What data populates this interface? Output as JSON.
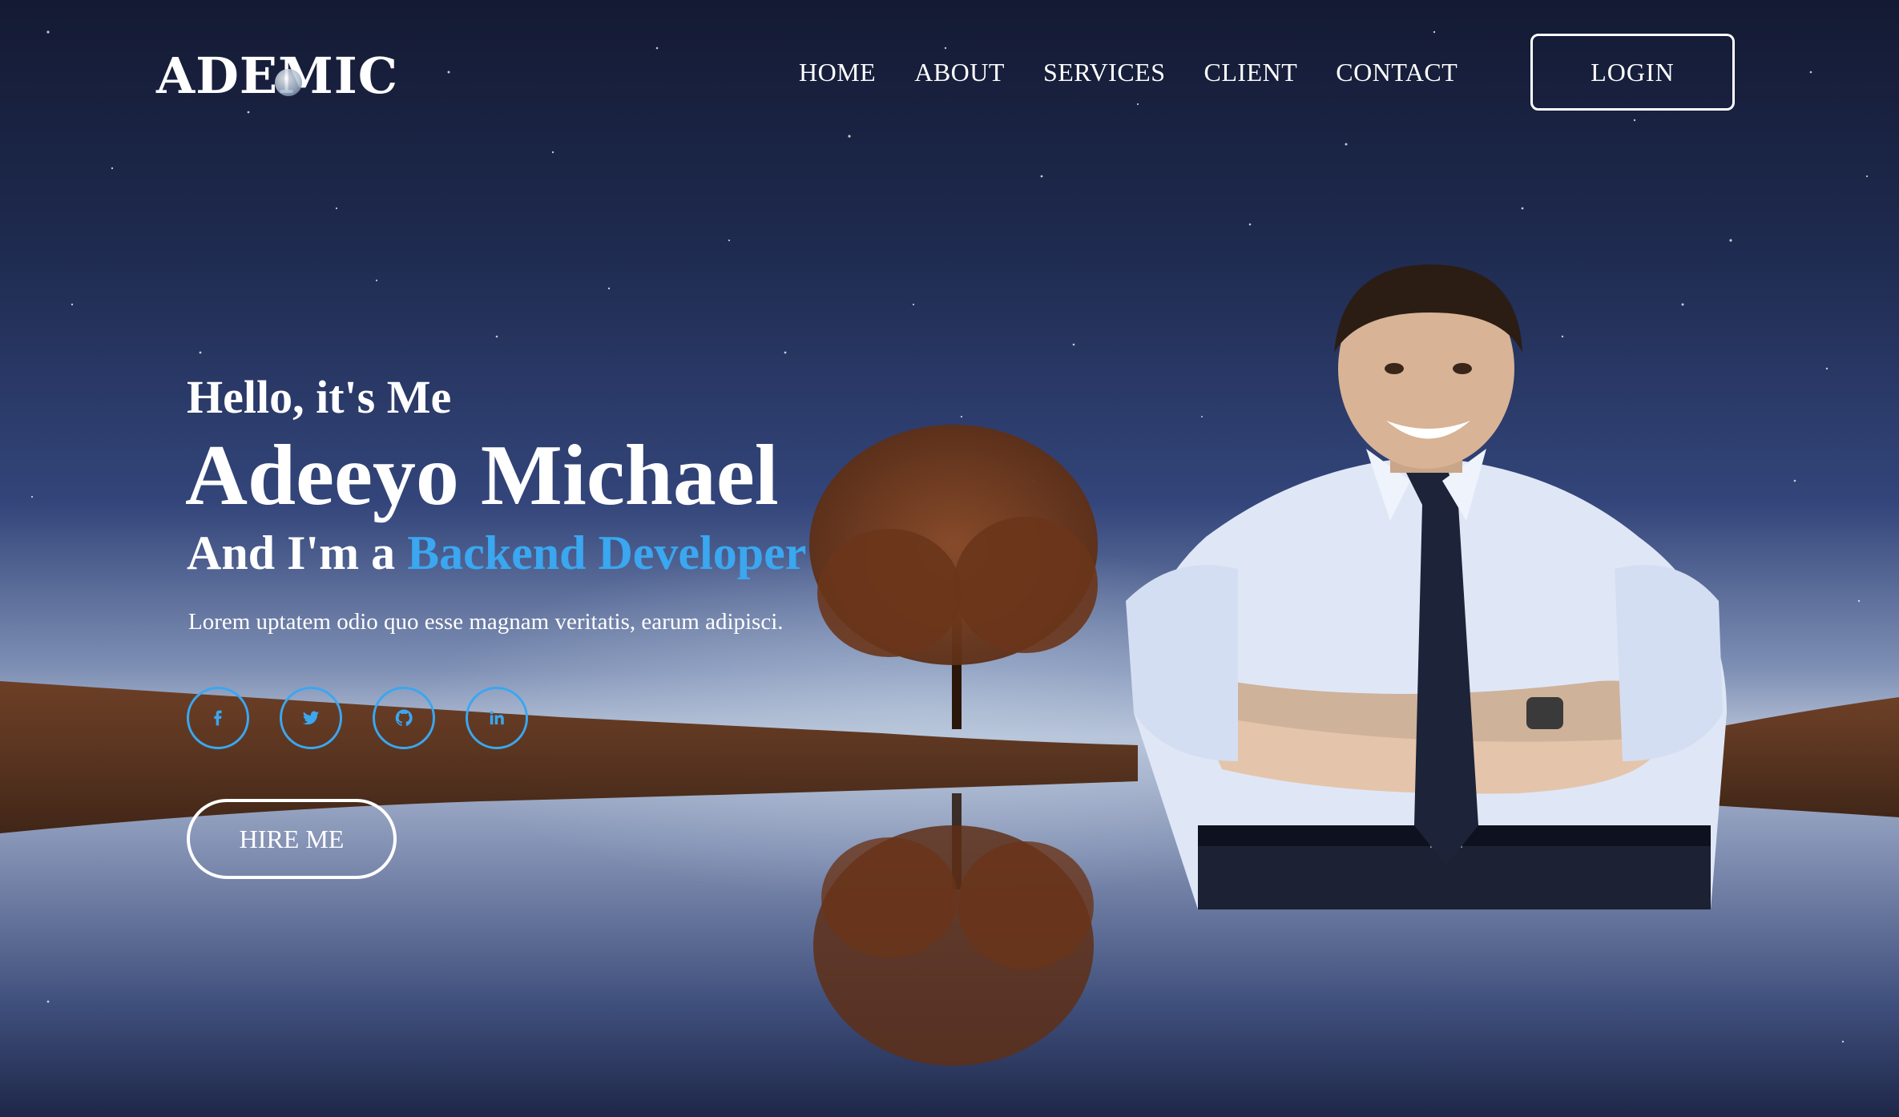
{
  "brand": {
    "logo_text": "ADEMIC"
  },
  "nav": {
    "items": [
      {
        "label": "HOME"
      },
      {
        "label": "ABOUT"
      },
      {
        "label": "SERVICES"
      },
      {
        "label": "CLIENT"
      },
      {
        "label": "CONTACT"
      }
    ],
    "login_label": "LOGIN"
  },
  "hero": {
    "greeting": "Hello, it's Me",
    "name": "Adeeyo Michael",
    "role_prefix": "And I'm a ",
    "role": "Backend Developer",
    "description": "Lorem uptatem odio quo esse magnam veritatis, earum adipisci.",
    "hire_label": "HIRE ME"
  },
  "socials": [
    {
      "icon": "facebook-icon",
      "glyph": "f"
    },
    {
      "icon": "twitter-icon",
      "glyph": "t"
    },
    {
      "icon": "github-icon",
      "glyph": "gh"
    },
    {
      "icon": "linkedin-icon",
      "glyph": "in"
    }
  ],
  "colors": {
    "accent": "#3aa7f0",
    "text": "#ffffff",
    "sky_top": "#141a33",
    "horizon": "#b5c1d6"
  }
}
